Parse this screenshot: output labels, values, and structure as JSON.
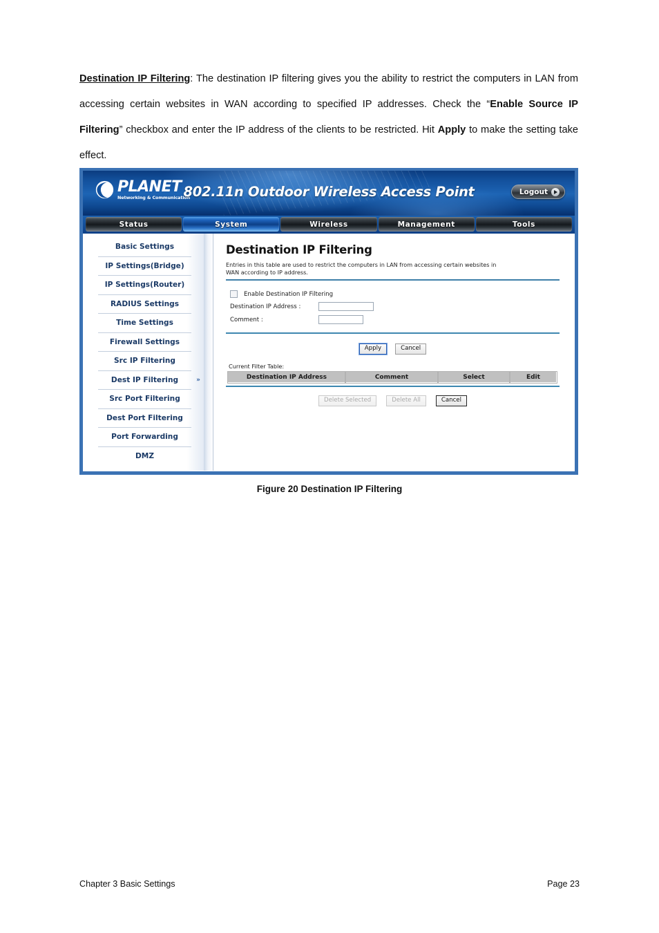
{
  "document": {
    "paragraph": {
      "lead": "Destination IP Filtering",
      "part1": ": The destination IP filtering gives you the ability to restrict the computers in LAN from accessing certain websites in WAN according to specified IP addresses.   Check the “",
      "bold1": "Enable Source IP Filtering",
      "part2": "” checkbox and enter the IP address of the clients to be restricted.   Hit ",
      "bold2": "Apply",
      "part3": " to make the setting take effect."
    },
    "figure_caption": "Figure 20 Destination IP Filtering",
    "footer": {
      "left": "Chapter 3 Basic Settings",
      "right": "Page 23"
    }
  },
  "ui": {
    "banner": {
      "logo_word": "PLANET",
      "logo_tagline": "Networking & Communication",
      "title": "802.11n Outdoor Wireless Access Point",
      "logout_label": "Logout"
    },
    "nav_tabs": [
      {
        "label": "Status",
        "active": false
      },
      {
        "label": "System",
        "active": true
      },
      {
        "label": "Wireless",
        "active": false
      },
      {
        "label": "Management",
        "active": false
      },
      {
        "label": "Tools",
        "active": false
      }
    ],
    "sidebar": {
      "items": [
        {
          "label": "Basic Settings",
          "active": false
        },
        {
          "label": "IP Settings(Bridge)",
          "active": false
        },
        {
          "label": "IP Settings(Router)",
          "active": false
        },
        {
          "label": "RADIUS Settings",
          "active": false
        },
        {
          "label": "Time Settings",
          "active": false
        },
        {
          "label": "Firewall Settings",
          "active": false
        },
        {
          "label": "Src IP Filtering",
          "active": false
        },
        {
          "label": "Dest IP Filtering",
          "active": true
        },
        {
          "label": "Src Port Filtering",
          "active": false
        },
        {
          "label": "Dest Port Filtering",
          "active": false
        },
        {
          "label": "Port Forwarding",
          "active": false
        },
        {
          "label": "DMZ",
          "active": false
        }
      ],
      "active_marker": "»"
    },
    "content": {
      "title": "Destination IP Filtering",
      "description": "Entries in this table are used to restrict the computers in LAN from accessing certain websites in WAN according to IP address.",
      "enable_checkbox_label": "Enable Destination IP Filtering",
      "enable_checkbox_checked": false,
      "fields": [
        {
          "label": "Destination IP Address :",
          "value": ""
        },
        {
          "label": "Comment :",
          "value": ""
        }
      ],
      "apply_label": "Apply",
      "cancel_label": "Cancel",
      "table_caption": "Current Filter Table:",
      "table_headers": [
        "Destination IP Address",
        "Comment",
        "Select",
        "Edit"
      ],
      "table_rows": [],
      "delete_selected_label": "Delete Selected",
      "delete_all_label": "Delete All",
      "bottom_cancel_label": "Cancel"
    },
    "colors": {
      "frame_border": "#3b72b4",
      "banner_blue": "#13519d",
      "active_tab_blue": "#1f64bd",
      "rule_blue": "#3d7fa8",
      "table_header_gray": "#c0c0c0",
      "sidebar_text": "#1b3a66"
    }
  }
}
